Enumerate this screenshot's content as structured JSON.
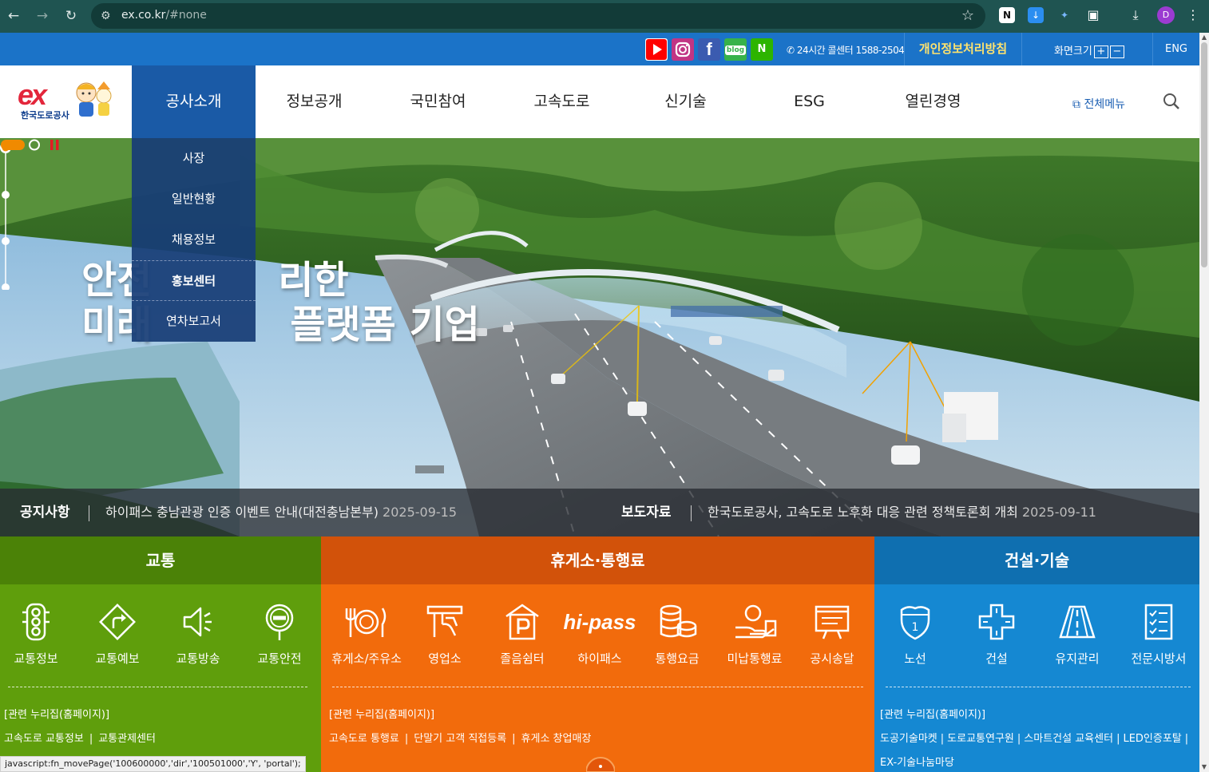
{
  "browser": {
    "url": "ex.co.kr",
    "url_hash": "/#none",
    "profile_initial": "D"
  },
  "utility": {
    "sns": [
      "youtube-icon",
      "instagram-icon",
      "facebook-icon",
      "blog-icon",
      "naver-icon"
    ],
    "blog_label": "blog",
    "naver_label": "N",
    "callcenter": "24시간 콜센터 1588-2504",
    "privacy": "개인정보처리방침",
    "font_size": "화면크기",
    "font_plus": "+",
    "font_minus": "−",
    "eng": "ENG"
  },
  "logo": {
    "brand": "ex",
    "name": "한국도로공사"
  },
  "gnb": {
    "menus": [
      "공사소개",
      "정보공개",
      "국민참여",
      "고속도로",
      "신기술",
      "ESG",
      "열린경영"
    ],
    "active_index": 0,
    "all_menu": "전체메뉴"
  },
  "dropdown": {
    "items": [
      "사장",
      "일반현황",
      "채용정보",
      "홍보센터",
      "연차보고서"
    ],
    "current_index": 3
  },
  "hero": {
    "title_line1": "안전하고 편리한",
    "title_line2": "미래교통 플랫폼 기업",
    "visible_line1_left": "안전",
    "visible_line1_right": "리한",
    "visible_line2_left": "미래",
    "visible_line2_right": "플랫폼 기업"
  },
  "notice": {
    "label": "공지사항",
    "text": "하이패스 충남관광 인증 이벤트 안내(대전충남본부)",
    "date": "2025-09-15"
  },
  "press": {
    "label": "보도자료",
    "text": "한국도로공사, 고속도로 노후화 대응 관련 정책토론회 개최",
    "date": "2025-09-11"
  },
  "quick": {
    "traffic": {
      "title": "교통",
      "color": "#5f9e0c",
      "head_color": "#4b8207",
      "items": [
        {
          "label": "교통정보",
          "icon": "traffic-light-icon"
        },
        {
          "label": "교통예보",
          "icon": "turn-sign-icon"
        },
        {
          "label": "교통방송",
          "icon": "speaker-icon"
        },
        {
          "label": "교통안전",
          "icon": "no-entry-sign-icon"
        }
      ],
      "related": "[관련 누리집(홈페이지)]",
      "links": [
        "고속도로 교통정보",
        "교통관제센터"
      ]
    },
    "rest": {
      "title": "휴게소·통행료",
      "color": "#f26b0c",
      "head_color": "#d2520a",
      "items": [
        {
          "label": "휴게소/주유소",
          "icon": "dining-icon"
        },
        {
          "label": "영업소",
          "icon": "tollgate-icon"
        },
        {
          "label": "졸음쉼터",
          "icon": "parking-icon"
        },
        {
          "label": "하이패스",
          "icon": "hipass-icon"
        },
        {
          "label": "통행요금",
          "icon": "coins-icon"
        },
        {
          "label": "미납통행료",
          "icon": "hand-coin-icon"
        },
        {
          "label": "공시송달",
          "icon": "notice-board-icon"
        }
      ],
      "hipass_text": "hi-pass",
      "related": "[관련 누리집(홈페이지)]",
      "links": [
        "고속도로 통행료",
        "단말기 고객 직접등록",
        "휴게소 창업매장"
      ]
    },
    "construction": {
      "title": "건설·기술",
      "color": "#1588d2",
      "head_color": "#0f6fb0",
      "items": [
        {
          "label": "노선",
          "icon": "route-shield-icon"
        },
        {
          "label": "건설",
          "icon": "crossroad-icon"
        },
        {
          "label": "유지관리",
          "icon": "road-icon"
        },
        {
          "label": "전문시방서",
          "icon": "checklist-icon"
        }
      ],
      "route_number": "1",
      "related": "[관련 누리집(홈페이지)]",
      "links": [
        "도공기술마켓",
        "도로교통연구원",
        "스마트건설 교육센터",
        "LED인증포탈"
      ],
      "links2": [
        "EX-기술나눔마당"
      ]
    }
  },
  "status": "javascript:fn_movePage('100600000','dir','100501000','Y', 'portal');"
}
